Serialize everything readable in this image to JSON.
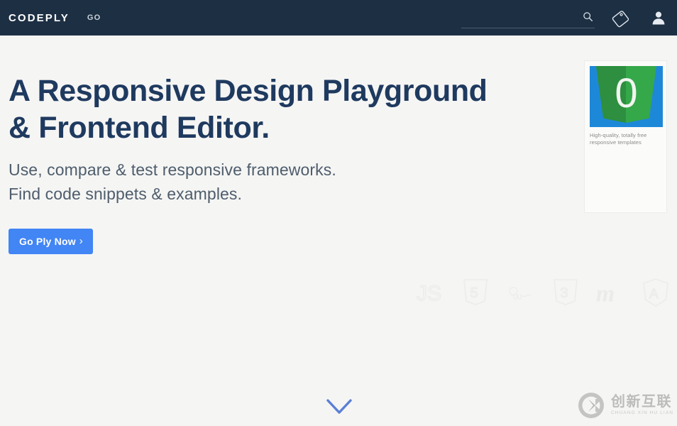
{
  "colors": {
    "navbar_bg": "#1d2f43",
    "page_bg": "#f5f5f4",
    "heading": "#1f3a5f",
    "subheading": "#4e5d6c",
    "accent_blue": "#4285f4",
    "shield_green": "#35a84a",
    "thumb_blue": "#1e88d8",
    "watermark_gray": "#b9b9b7"
  },
  "navbar": {
    "brand": "CODEPLY",
    "links": [
      {
        "label": "GO",
        "name": "nav-link-go"
      }
    ],
    "search": {
      "value": "",
      "placeholder": ""
    },
    "icons": {
      "search": "search-icon",
      "tag": "tag-icon",
      "user": "user-icon"
    }
  },
  "hero": {
    "title_line1": "A Responsive Design Playground",
    "title_line2": "& Frontend Editor.",
    "sub_line1": "Use, compare & test responsive frameworks.",
    "sub_line2": "Find code snippets & examples.",
    "cta": {
      "label": "Go Ply Now",
      "chevron": "›"
    }
  },
  "template_card": {
    "badge_number": "0",
    "caption_line1": "High-quality, totally free",
    "caption_line2": "responsive templates"
  },
  "framework_logos": [
    {
      "name": "javascript-logo-icon",
      "label": "JS"
    },
    {
      "name": "html5-logo-icon",
      "label": "5"
    },
    {
      "name": "sass-logo-icon",
      "label": "Sass"
    },
    {
      "name": "css3-logo-icon",
      "label": "3"
    },
    {
      "name": "materialize-logo-icon",
      "label": "M"
    },
    {
      "name": "angular-logo-icon",
      "label": "A"
    }
  ],
  "scroll_indicator": {
    "name": "chevron-down-icon"
  },
  "watermark": {
    "chinese": "创新互联",
    "pinyin": "CHUANG XIN HU LIAN",
    "mark": "CX"
  }
}
